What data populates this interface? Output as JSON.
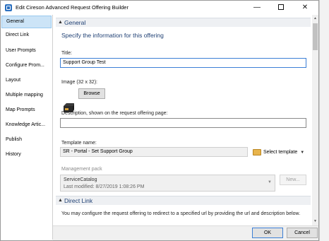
{
  "window": {
    "title": "Edit Cireson Advanced Request Offering Builder",
    "minimize": "—",
    "close": "✕"
  },
  "nav": {
    "items": [
      "General",
      "Direct Link",
      "User Prompts",
      "Configure Prom...",
      "Layout",
      "Multiple mapping",
      "Map Prompts",
      "Knowledge Artic...",
      "Publish",
      "History"
    ],
    "selected": "General"
  },
  "general": {
    "header": "General",
    "subtitle": "Specify the information for this offering",
    "title_label": "Title:",
    "title_value": "Support Group Test",
    "image_label": "Image (32 x 32):",
    "browse_button": "Browse",
    "description_label": "Description, shown on the request offering page:",
    "description_value": "",
    "template_label": "Template name:",
    "template_value": "SR - Portal - Set Support Group",
    "select_template": "Select template",
    "mp_label": "Management pack",
    "mp_name": "ServiceCatalog",
    "mp_modified": "Last modified:  8/27/2019 1:08:26 PM",
    "new_button": "New..."
  },
  "direct_link": {
    "header": "Direct Link",
    "text": "You may configure the request offering to redirect to a specified url by providing the url and description below."
  },
  "footer": {
    "ok": "OK",
    "cancel": "Cancel"
  }
}
